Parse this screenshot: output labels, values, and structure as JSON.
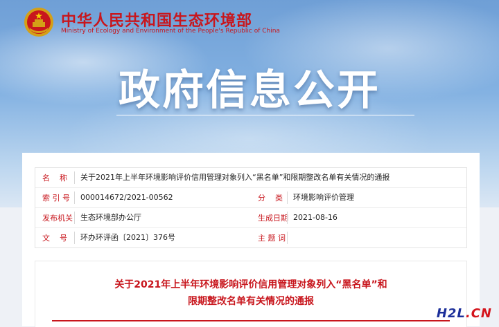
{
  "header": {
    "site_name_cn": "中华人民共和国生态环境部",
    "site_name_en": "Ministry of Ecology and Environment of the People's Republic of China",
    "emblem_icon": "national-emblem-icon"
  },
  "hero": {
    "title": "政府信息公开"
  },
  "meta": {
    "name_label": "名    称",
    "name_value": "关于2021年上半年环境影响评价信用管理对象列入“黑名单”和限期整改名单有关情况的通报",
    "index_label": "索 引 号",
    "index_value": "000014672/2021-00562",
    "category_label": "分    类",
    "category_value": "环境影响评价管理",
    "issuer_label": "发布机关",
    "issuer_value": "生态环境部办公厅",
    "date_label": "生成日期",
    "date_value": "2021-08-16",
    "docno_label": "文    号",
    "docno_value": "环办环评函〔2021〕376号",
    "subject_label": "主 题 词",
    "subject_value": ""
  },
  "document": {
    "title_line1": "关于2021年上半年环境影响评价信用管理对象列入“黑名单”和",
    "title_line2": "限期整改名单有关情况的通报"
  },
  "watermark": {
    "part1": "H2L",
    "part2": ".CN"
  },
  "colors": {
    "accent_red": "#c8161d",
    "sky_blue": "#84b2e2"
  }
}
